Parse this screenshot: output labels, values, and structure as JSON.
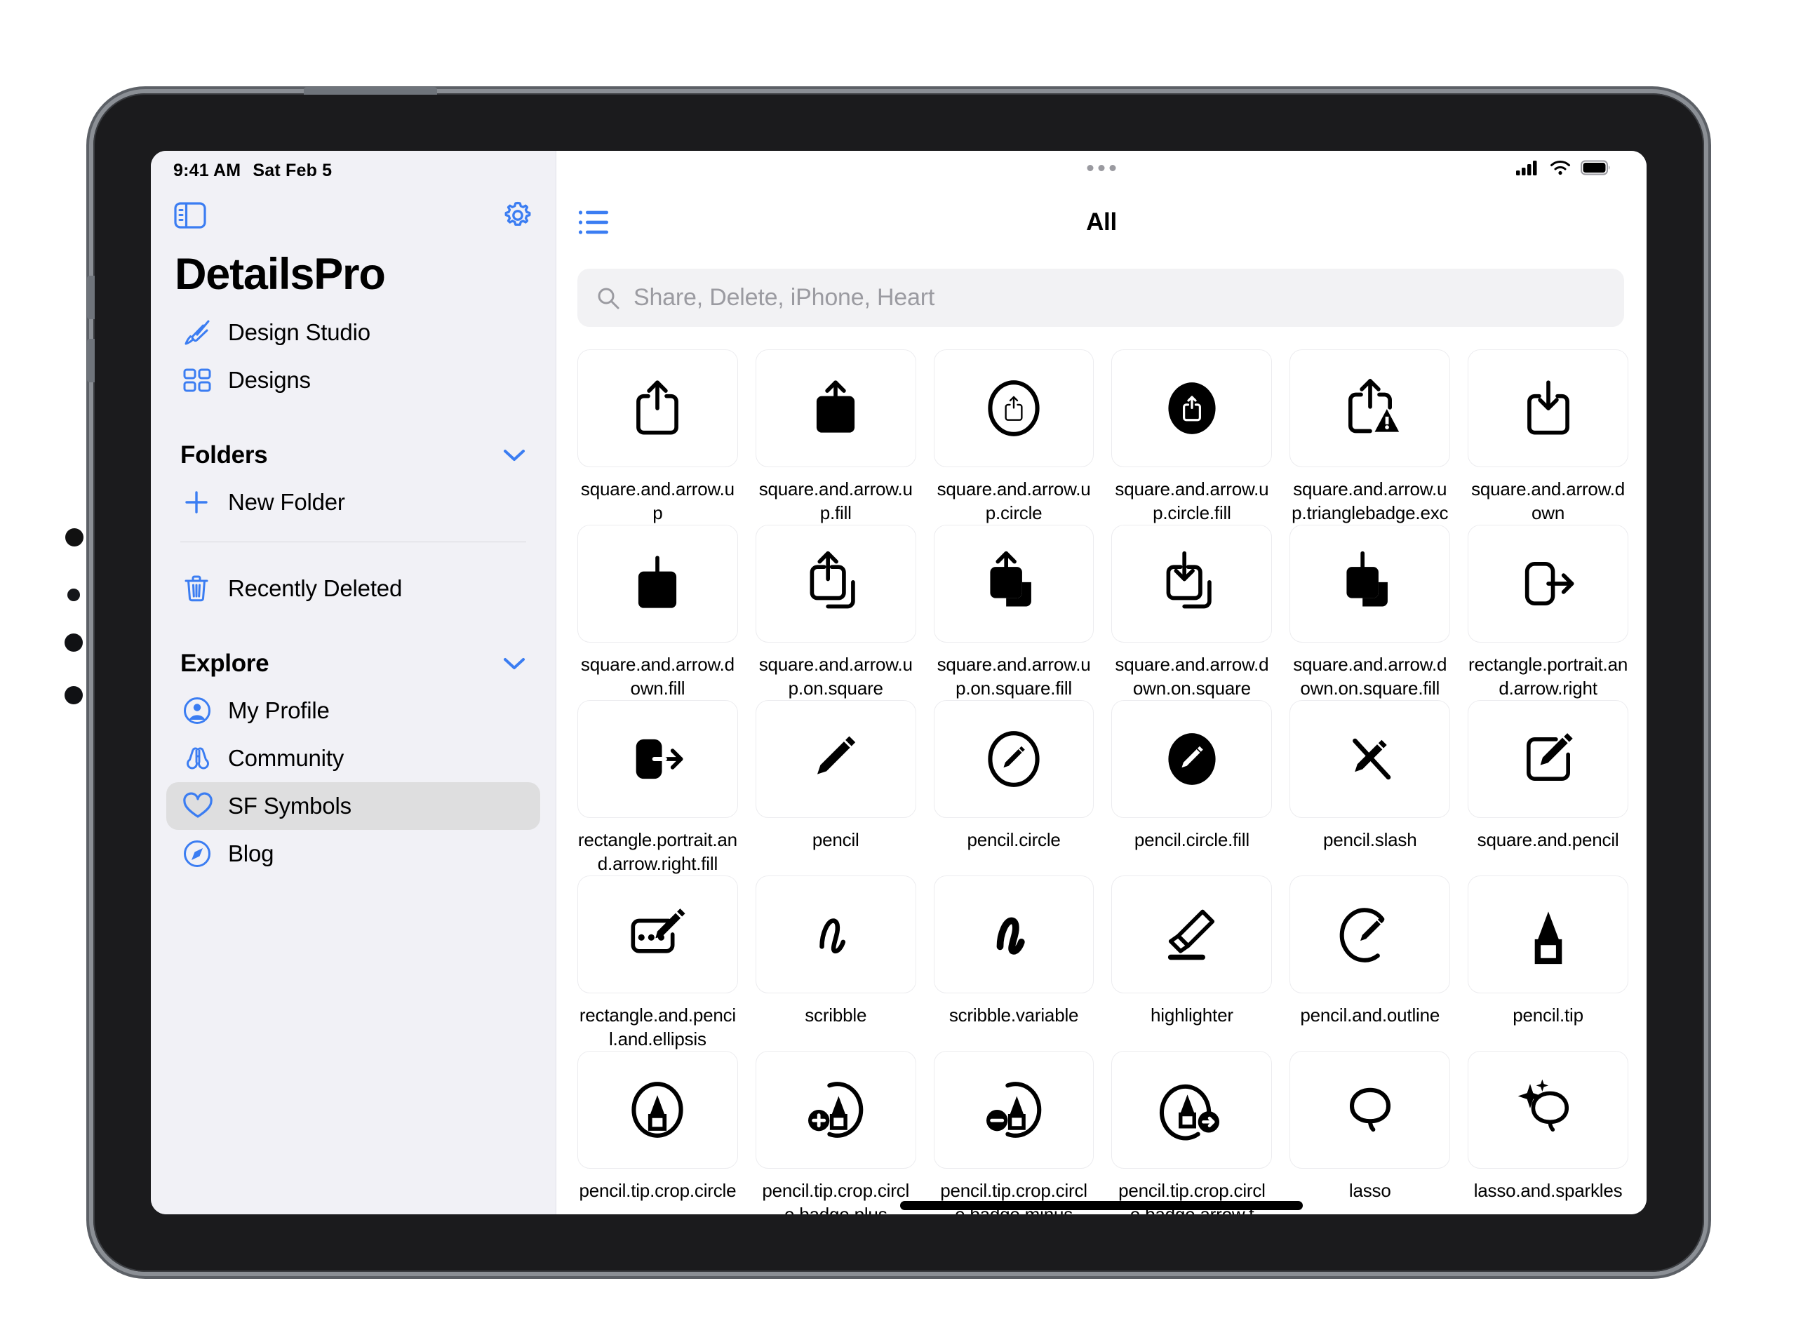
{
  "status_bar": {
    "time": "9:41 AM",
    "date": "Sat Feb 5",
    "cellular_icon": "cellular-bars-icon",
    "wifi_icon": "wifi-icon",
    "battery_icon": "battery-icon"
  },
  "sidebar": {
    "toggle_sidebar_icon": "sidebar-toggle-icon",
    "settings_icon": "gear-icon",
    "app_title": "DetailsPro",
    "primary_items": [
      {
        "label": "Design Studio",
        "icon": "paintbrush-icon"
      },
      {
        "label": "Designs",
        "icon": "grid-squares-icon"
      }
    ],
    "folders_section": {
      "title": "Folders",
      "chevron_icon": "chevron-down-icon",
      "items": [
        {
          "label": "New Folder",
          "icon": "plus-icon"
        }
      ]
    },
    "trash_item": {
      "label": "Recently Deleted",
      "icon": "trash-icon"
    },
    "explore_section": {
      "title": "Explore",
      "chevron_icon": "chevron-down-icon",
      "items": [
        {
          "label": "My Profile",
          "icon": "person-circle-icon",
          "selected": false
        },
        {
          "label": "Community",
          "icon": "binoculars-icon",
          "selected": false
        },
        {
          "label": "SF Symbols",
          "icon": "heart-icon",
          "selected": true
        },
        {
          "label": "Blog",
          "icon": "safari-compass-icon",
          "selected": false
        }
      ]
    }
  },
  "main": {
    "list_view_icon": "list-bullet-icon",
    "title": "All",
    "window_handle_icon": "three-dots-handle-icon",
    "search": {
      "icon": "search-icon",
      "value": "",
      "placeholder": "Share, Delete, iPhone, Heart"
    },
    "symbols": [
      {
        "name": "square.and.arrow.up",
        "icon": "share-up"
      },
      {
        "name": "square.and.arrow.up.fill",
        "icon": "share-up-fill"
      },
      {
        "name": "square.and.arrow.up.circle",
        "icon": "share-up-circle"
      },
      {
        "name": "square.and.arrow.up.circle.fill",
        "icon": "share-up-circle-fill"
      },
      {
        "name": "square.and.arrow.up.trianglebadge.exc",
        "icon": "share-up-warning"
      },
      {
        "name": "square.and.arrow.down",
        "icon": "share-down"
      },
      {
        "name": "square.and.arrow.down.fill",
        "icon": "share-down-fill"
      },
      {
        "name": "square.and.arrow.up.on.square",
        "icon": "share-up-on-square"
      },
      {
        "name": "square.and.arrow.up.on.square.fill",
        "icon": "share-up-on-square-fill"
      },
      {
        "name": "square.and.arrow.down.on.square",
        "icon": "share-down-on-square"
      },
      {
        "name": "square.and.arrow.down.on.square.fill",
        "icon": "share-down-on-square-fill"
      },
      {
        "name": "rectangle.portrait.and.arrow.right",
        "icon": "rect-arrow-right"
      },
      {
        "name": "rectangle.portrait.and.arrow.right.fill",
        "icon": "rect-arrow-right-fill"
      },
      {
        "name": "pencil",
        "icon": "pencil"
      },
      {
        "name": "pencil.circle",
        "icon": "pencil-circle"
      },
      {
        "name": "pencil.circle.fill",
        "icon": "pencil-circle-fill"
      },
      {
        "name": "pencil.slash",
        "icon": "pencil-slash"
      },
      {
        "name": "square.and.pencil",
        "icon": "square-and-pencil"
      },
      {
        "name": "rectangle.and.pencil.and.ellipsis",
        "icon": "rect-pencil-ellipsis"
      },
      {
        "name": "scribble",
        "icon": "scribble"
      },
      {
        "name": "scribble.variable",
        "icon": "scribble-variable"
      },
      {
        "name": "highlighter",
        "icon": "highlighter"
      },
      {
        "name": "pencil.and.outline",
        "icon": "pencil-and-outline"
      },
      {
        "name": "pencil.tip",
        "icon": "pencil-tip"
      },
      {
        "name": "pencil.tip.crop.circle",
        "icon": "pencil-tip-crop-circle"
      },
      {
        "name": "pencil.tip.crop.circle.badge.plus",
        "icon": "pencil-tip-crop-circle-plus"
      },
      {
        "name": "pencil.tip.crop.circle.badge.minus",
        "icon": "pencil-tip-crop-circle-minus"
      },
      {
        "name": "pencil.tip.crop.circle.badge.arrow.f",
        "icon": "pencil-tip-crop-circle-arrow"
      },
      {
        "name": "lasso",
        "icon": "lasso"
      },
      {
        "name": "lasso.and.sparkles",
        "icon": "lasso-sparkles"
      }
    ]
  },
  "colors": {
    "accent_blue": "#3b7df2",
    "sidebar_bg": "#f1f1f6",
    "selected_row": "#dededf",
    "search_bg": "#f2f2f4",
    "symbol_black": "#000000"
  }
}
